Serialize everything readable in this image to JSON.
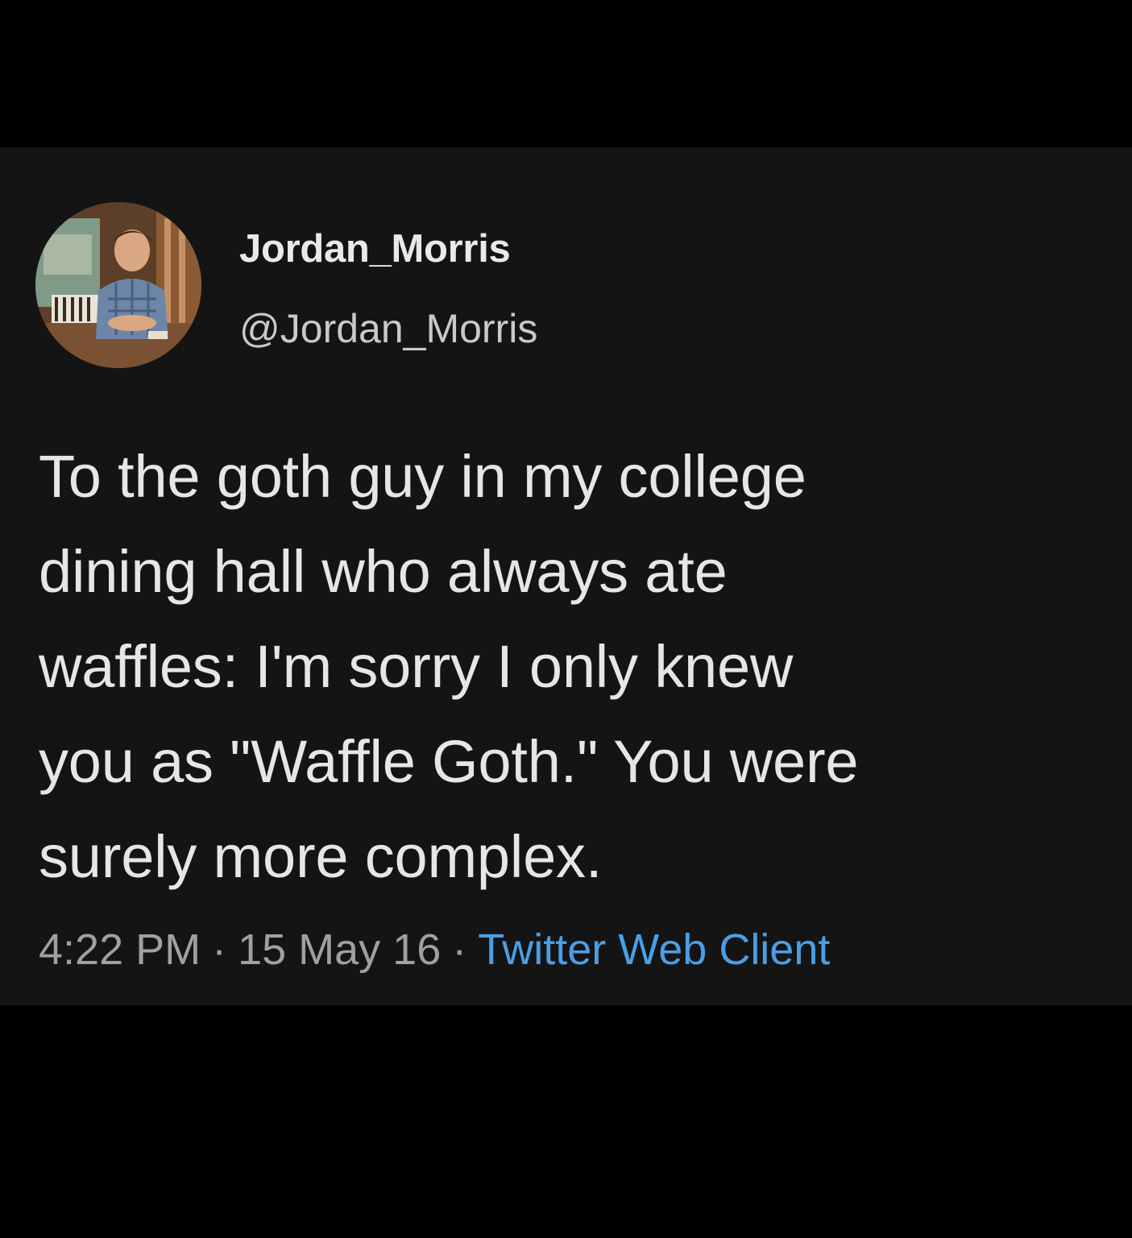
{
  "tweet": {
    "display_name": "Jordan_Morris",
    "handle": "@Jordan_Morris",
    "text": "To the goth guy in my college\ndining hall who always ate\nwaffles: I'm sorry I only knew\nyou as \"Waffle Goth.\" You were\nsurely more complex.",
    "time": "4:22 PM",
    "separator": "·",
    "date": "15 May 16",
    "source": "Twitter Web Client"
  },
  "colors": {
    "page_background": "#000000",
    "card_background": "#141414",
    "primary_text": "#e6e6e6",
    "secondary_text": "#a0a0a0",
    "link": "#4a9fe6"
  },
  "icons": {
    "avatar": "profile-photo"
  }
}
